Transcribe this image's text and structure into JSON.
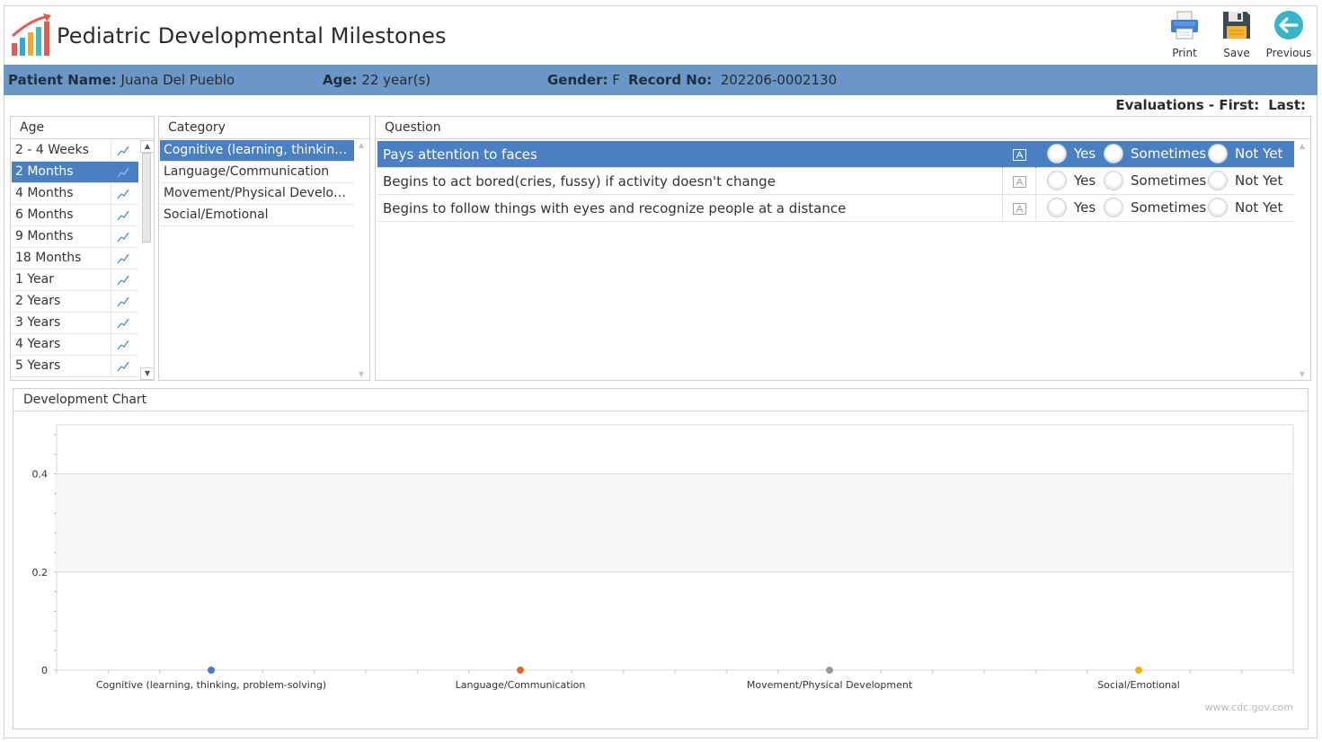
{
  "app": {
    "title": "Pediatric Developmental Milestones"
  },
  "toolbar": {
    "print_label": "Print",
    "save_label": "Save",
    "previous_label": "Previous"
  },
  "patient": {
    "name_label": "Patient Name:",
    "name": "Juana Del Pueblo",
    "age_label": "Age:",
    "age": "22 year(s)",
    "gender_label": "Gender:",
    "gender": "F",
    "record_label": "Record No:",
    "record": "202206-0002130"
  },
  "evaluations": {
    "label": "Evaluations - First:",
    "last_label": "Last:"
  },
  "age_panel": {
    "header": "Age",
    "items": [
      "2 - 4 Weeks",
      "2 Months",
      "4 Months",
      "6 Months",
      "9 Months",
      "18 Months",
      "1 Year",
      "2 Years",
      "3 Years",
      "4 Years",
      "5 Years"
    ],
    "selected_index": 1
  },
  "category_panel": {
    "header": "Category",
    "items": [
      "Cognitive (learning, thinking, pr...",
      "Language/Communication",
      "Movement/Physical Developme...",
      "Social/Emotional"
    ],
    "selected_index": 0
  },
  "question_panel": {
    "header": "Question",
    "options": [
      "Yes",
      "Sometimes",
      "Not Yet"
    ],
    "questions": [
      "Pays attention to faces",
      "Begins to act bored(cries, fussy) if activity doesn't change",
      "Begins to follow things with eyes and recognize people at a distance"
    ],
    "selected_index": 0
  },
  "chart_panel": {
    "header": "Development Chart",
    "watermark": "www.cdc.gov.com"
  },
  "chart_data": {
    "type": "scatter",
    "categories": [
      "Cognitive (learning, thinking, problem-solving)",
      "Language/Communication",
      "Movement/Physical Development",
      "Social/Emotional"
    ],
    "values": [
      0,
      0,
      0,
      0
    ],
    "point_colors": [
      "#4a7fc1",
      "#e06b2e",
      "#9a9a9a",
      "#f0b400"
    ],
    "ylim": [
      0,
      0.5
    ],
    "yticks": [
      0,
      0.2,
      0.4
    ],
    "ytick_labels": [
      "0",
      "0.2",
      "0.4"
    ],
    "grid": true
  },
  "colors": {
    "accent": "#4a7fc1",
    "band": "#6b96c8"
  }
}
